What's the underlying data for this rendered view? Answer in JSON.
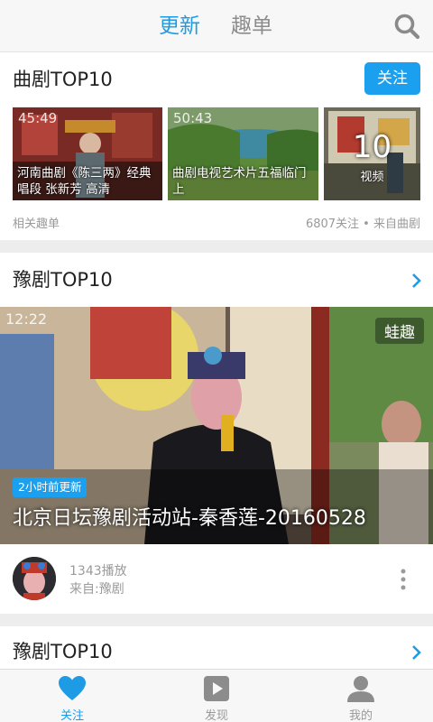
{
  "header": {
    "tabs": [
      {
        "label": "更新",
        "active": true
      },
      {
        "label": "趣单",
        "active": false
      }
    ]
  },
  "card1": {
    "title": "曲剧TOP10",
    "follow_label": "关注",
    "videos": [
      {
        "duration": "45:49",
        "caption": "河南曲剧《陈三两》经典唱段 张新芳 高清"
      },
      {
        "duration": "50:43",
        "caption": "曲剧电视艺术片五福临门上"
      }
    ],
    "count": "10",
    "count_unit": "视频",
    "related": "相关趣单",
    "meta": "6807关注 • 来自曲剧"
  },
  "card2": {
    "title": "豫剧TOP10",
    "video": {
      "duration": "12:22",
      "brand": "蛙趣",
      "badge": "2小时前更新",
      "title": "北京日坛豫剧活动站-秦香莲-20160528"
    },
    "plays": "1343播放",
    "source": "来自:豫剧"
  },
  "card3": {
    "title": "豫剧TOP10"
  },
  "bottom_nav": [
    {
      "label": "关注",
      "icon": "heart-icon",
      "active": true
    },
    {
      "label": "发现",
      "icon": "play-icon",
      "active": false
    },
    {
      "label": "我的",
      "icon": "person-icon",
      "active": false
    }
  ],
  "colors": {
    "accent": "#1e9be5",
    "button": "#1aa0ee",
    "muted_text": "#9a9a9a",
    "background": "#ededed"
  }
}
